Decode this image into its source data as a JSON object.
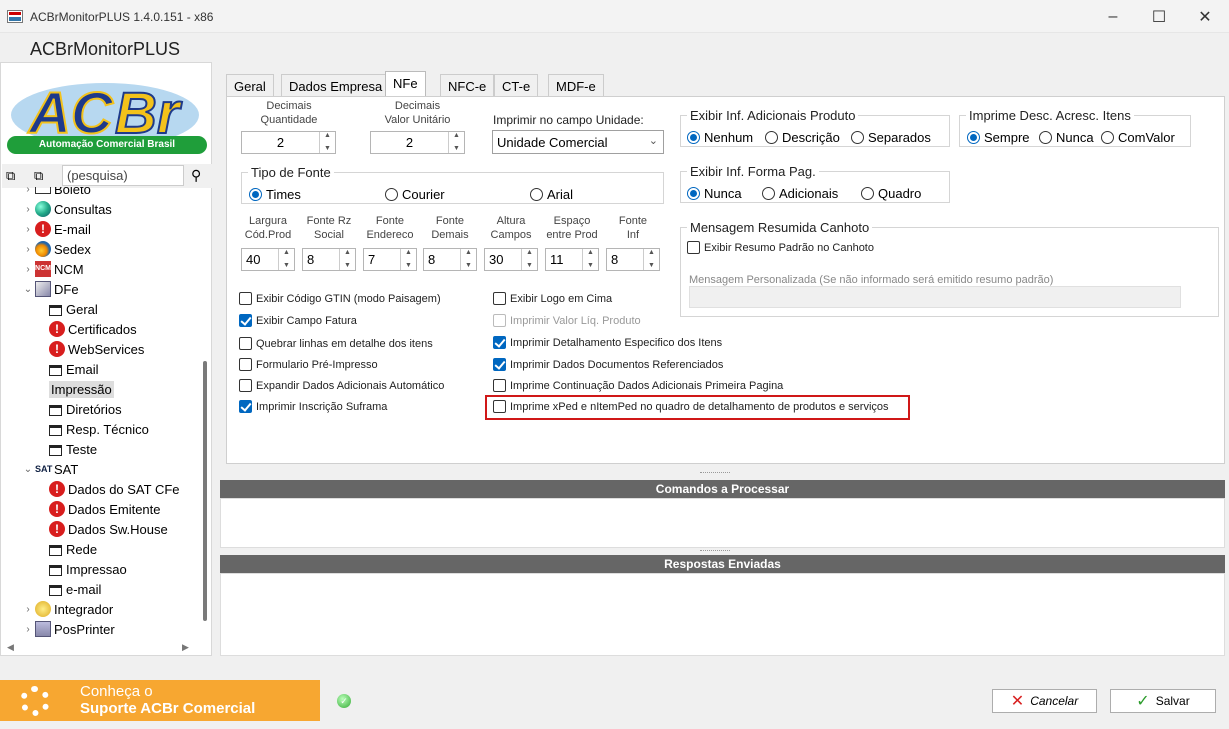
{
  "window": {
    "title": "ACBrMonitorPLUS 1.4.0.151 - x86",
    "header": "ACBrMonitorPLUS"
  },
  "logo": {
    "text": "ACBr",
    "tagline": "Automação Comercial Brasil"
  },
  "search": {
    "placeholder": "(pesquisa)"
  },
  "tree": {
    "top_partial": "Boleto",
    "items": [
      {
        "label": "Consultas"
      },
      {
        "label": "E-mail"
      },
      {
        "label": "Sedex"
      },
      {
        "label": "NCM"
      },
      {
        "label": "DFe"
      },
      {
        "label": "Geral"
      },
      {
        "label": "Certificados"
      },
      {
        "label": "WebServices"
      },
      {
        "label": "Email"
      },
      {
        "label": "Impressão"
      },
      {
        "label": "Diretórios"
      },
      {
        "label": "Resp. Técnico"
      },
      {
        "label": "Teste"
      },
      {
        "label": "SAT"
      },
      {
        "label": "Dados do SAT CFe"
      },
      {
        "label": "Dados Emitente"
      },
      {
        "label": "Dados Sw.House"
      },
      {
        "label": "Rede"
      },
      {
        "label": "Impressao"
      },
      {
        "label": "e-mail"
      },
      {
        "label": "Integrador"
      },
      {
        "label": "PosPrinter"
      }
    ]
  },
  "tabs": [
    "Geral",
    "Dados Empresa",
    "NFe",
    "NFC-e",
    "CT-e",
    "MDF-e"
  ],
  "nfe": {
    "dec_qtd_label1": "Decimais",
    "dec_qtd_label2": "Quantidade",
    "dec_qtd": "2",
    "dec_vu_label1": "Decimais",
    "dec_vu_label2": "Valor Unitário",
    "dec_vu": "2",
    "unidade_label": "Imprimir no campo Unidade:",
    "unidade_value": "Unidade Comercial",
    "inf_adic_title": "Exibir Inf. Adicionais Produto",
    "inf_adic_opts": [
      "Nenhum",
      "Descrição",
      "Separados"
    ],
    "desc_acresc_title": "Imprime Desc. Acresc. Itens",
    "desc_acresc_opts": [
      "Sempre",
      "Nunca",
      "ComValor"
    ],
    "fonte_title": "Tipo de Fonte",
    "fonte_opts": [
      "Times",
      "Courier",
      "Arial"
    ],
    "forma_pag_title": "Exibir Inf. Forma Pag.",
    "forma_pag_opts": [
      "Nunca",
      "Adicionais",
      "Quadro"
    ],
    "canhoto_title": "Mensagem Resumida Canhoto",
    "canhoto_check": "Exibir Resumo Padrão no Canhoto",
    "canhoto_msg_label": "Mensagem Personalizada   (Se não informado será emitido resumo padrão)",
    "spins": [
      {
        "l1": "Largura",
        "l2": "Cód.Prod",
        "v": "40"
      },
      {
        "l1": "Fonte Rz",
        "l2": "Social",
        "v": "8"
      },
      {
        "l1": "Fonte",
        "l2": "Endereco",
        "v": "7"
      },
      {
        "l1": "Fonte",
        "l2": "Demais",
        "v": "8"
      },
      {
        "l1": "Altura",
        "l2": "Campos",
        "v": "30"
      },
      {
        "l1": "Espaço",
        "l2": "entre Prod",
        "v": "11"
      },
      {
        "l1": "Fonte",
        "l2": "Inf",
        "v": "8"
      }
    ],
    "checks_left": [
      "Exibir Código GTIN (modo Paisagem)",
      "Exibir Campo Fatura",
      "Quebrar linhas em detalhe dos itens",
      "Formulario Pré-Impresso",
      "Expandir Dados Adicionais Automático",
      "Imprimir Inscrição Suframa"
    ],
    "checks_right": [
      "Exibir Logo em Cima",
      "Imprimir Valor Líq. Produto",
      "Imprimir Detalhamento Especifico dos Itens",
      "Imprimir Dados Documentos Referenciados",
      "Imprime Continuação Dados Adicionais Primeira Pagina",
      "Imprime xPed e nItemPed no quadro de detalhamento de produtos e serviços"
    ]
  },
  "commands_title": "Comandos a Processar",
  "responses_title": "Respostas Enviadas",
  "banner": {
    "line1": "Conheça o",
    "line2": "Suporte ACBr Comercial"
  },
  "buttons": {
    "cancel": "Cancelar",
    "save": "Salvar"
  },
  "colors": {
    "accent": "#0067c0",
    "highlight": "#d01818",
    "banner": "#f7a731",
    "bar": "#666666"
  }
}
